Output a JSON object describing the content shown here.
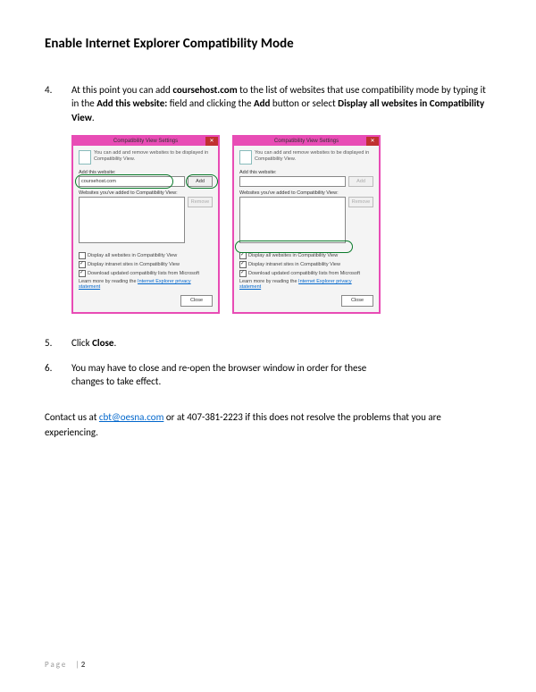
{
  "title": "Enable Internet Explorer Compatibility Mode",
  "steps": {
    "s4": {
      "num": "4.",
      "t1": "At this point you can add ",
      "t2": "coursehost.com",
      "t3": " to the list of websites that use compatibility mode by typing it in the ",
      "t4": "Add this website:",
      "t5": " field and clicking the ",
      "t6": "Add",
      "t7": " button or select ",
      "t8": "Display all websites in Compatibility View",
      "t9": "."
    },
    "s5": {
      "num": "5.",
      "t1": "Click ",
      "t2": "Close",
      "t3": "."
    },
    "s6": {
      "num": "6.",
      "t1": "You may have to close and re-open the browser window in order for these changes to take effect."
    }
  },
  "dialog": {
    "title": "Compatibility View Settings",
    "intro": "You can add and remove websites to be displayed in Compatibility View.",
    "add_label": "Add this website:",
    "input_value": "coursehost.com",
    "add_btn": "Add",
    "list_label": "Websites you've added to Compatibility View:",
    "remove_btn": "Remove",
    "chk1": "Display all websites in Compatibility View",
    "chk2": "Display intranet sites in Compatibility View",
    "chk3": "Download updated compatibility lists from Microsoft",
    "learn": "Learn more by reading the ",
    "learn_link": "Internet Explorer privacy statement",
    "close_btn": "Close"
  },
  "contact": {
    "t1": "Contact us at ",
    "email": "cbt@oesna.com",
    "t2": " or at 407-381-2223 if this does not resolve the problems that you are experiencing."
  },
  "footer": {
    "label": "Page",
    "sep": "|",
    "num": "2"
  }
}
